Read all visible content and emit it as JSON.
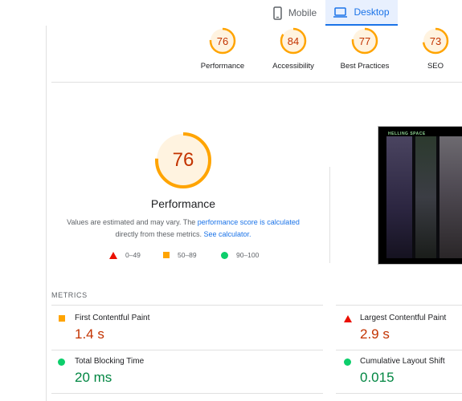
{
  "tabs": {
    "mobile": "Mobile",
    "desktop": "Desktop"
  },
  "scores": [
    {
      "label": "Performance",
      "value": "76",
      "fraction": 0.76
    },
    {
      "label": "Accessibility",
      "value": "84",
      "fraction": 0.84
    },
    {
      "label": "Best Practices",
      "value": "77",
      "fraction": 0.77
    },
    {
      "label": "SEO",
      "value": "73",
      "fraction": 0.73
    }
  ],
  "main_gauge": {
    "value": "76",
    "fraction": 0.76,
    "title": "Performance"
  },
  "description": {
    "text1": "Values are estimated and may vary. The ",
    "link1": "performance score is calculated",
    "text2": "directly from these metrics. ",
    "link2": "See calculator."
  },
  "legend": {
    "fail": "0–49",
    "average": "50–89",
    "pass": "90–100"
  },
  "thumbnail": {
    "title": "HELLING SPACE"
  },
  "metrics": {
    "heading": "METRICS",
    "items": [
      {
        "label": "First Contentful Paint",
        "value": "1.4 s"
      },
      {
        "label": "Largest Contentful Paint",
        "value": "2.9 s"
      },
      {
        "label": "Total Blocking Time",
        "value": "20 ms"
      },
      {
        "label": "Cumulative Layout Shift",
        "value": "0.015"
      }
    ]
  },
  "colors": {
    "average_arc": "#ffa400",
    "average_bg": "#fff3e0",
    "average_text": "#c33300",
    "pass_text": "#018642",
    "accent": "#1a73e8"
  }
}
